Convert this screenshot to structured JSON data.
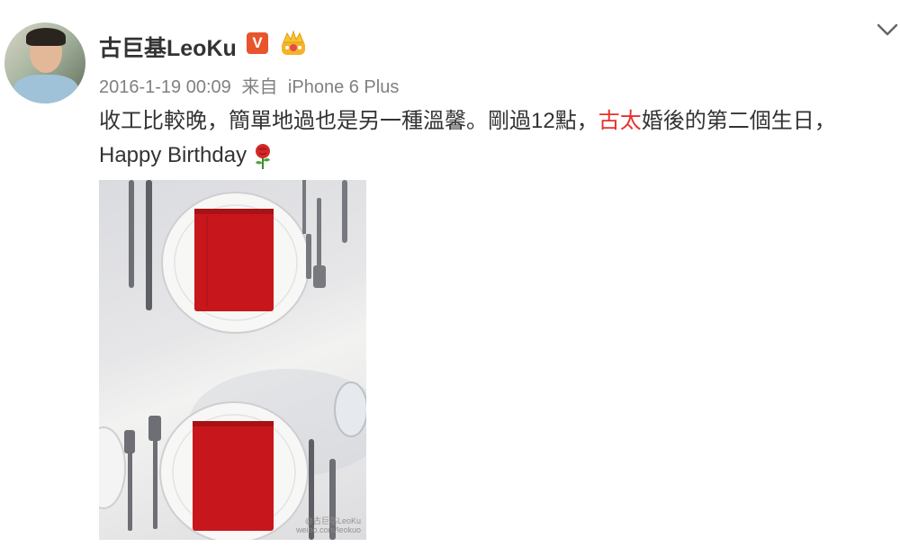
{
  "user": {
    "name": "古巨基LeoKu",
    "verified_badge": "V",
    "avatar_icon": "avatar",
    "crown_icon": "crown-icon"
  },
  "post": {
    "date": "2016-1-19 00:09",
    "source_prefix": "来自",
    "source": "iPhone 6 Plus",
    "text_part1": "收工比較晚，簡單地過也是另一種溫馨。剛過12點，",
    "text_link": "古太",
    "text_part2": "婚後的第二個生日，",
    "text_line2": "Happy Birthday",
    "emoji": "rose-icon",
    "link_color": "#e8312c"
  },
  "photo": {
    "watermark_line1": "@古巨基LeoKu",
    "watermark_line2": "weibo.com/leokuo"
  },
  "menu": {
    "icon": "chevron-down-icon"
  }
}
